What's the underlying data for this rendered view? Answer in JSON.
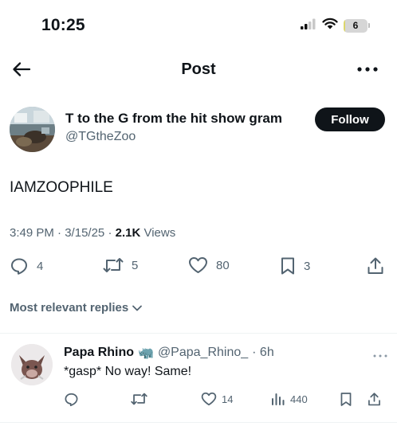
{
  "status_bar": {
    "time": "10:25",
    "battery_level": "6",
    "battery_fraction": 0.06
  },
  "header": {
    "title": "Post",
    "icons": [
      "back-arrow-icon",
      "more-horizontal-icon"
    ]
  },
  "post": {
    "author": {
      "name": "T to the G from the hit show gram",
      "handle": "@TGtheZoo",
      "follow_label": "Follow"
    },
    "text": "IAMZOOPHILE",
    "time": "3:49 PM",
    "date": "3/15/25",
    "separator": "·",
    "views_count": "2.1K",
    "views_label": "Views",
    "stats": {
      "replies": "4",
      "reposts": "5",
      "likes": "80",
      "bookmarks": "3"
    }
  },
  "replies_section": {
    "sort_label": "Most relevant replies"
  },
  "replies": [
    {
      "name": "Papa Rhino",
      "name_emoji": "🦏",
      "handle": "@Papa_Rhino_",
      "time": "· 6h",
      "text": "*gasp* No way! Same!",
      "stats": {
        "replies": "",
        "reposts": "",
        "likes": "14",
        "views": "440"
      }
    }
  ],
  "colors": {
    "text": "#0f1419",
    "secondary": "#536471",
    "divider": "#eff3f4",
    "button_bg": "#0f1419",
    "battery_fill": "#dcd66a"
  }
}
